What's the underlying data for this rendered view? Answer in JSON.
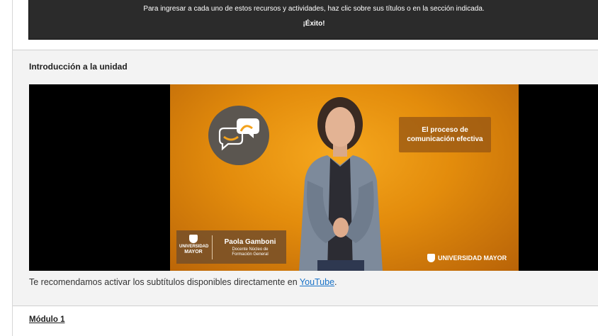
{
  "banner": {
    "instructions": "Para ingresar a cada uno de estos recursos y actividades, haz clic sobre sus títulos o en la sección indicada.",
    "success": "¡Éxito!"
  },
  "intro_section": {
    "title": "Introducción a la unidad",
    "video": {
      "card_title_line1": "El proceso de",
      "card_title_line2": "comunicación efectiva",
      "presenter_name": "Paola Gamboni",
      "presenter_role_line1": "Docente Núcleo de",
      "presenter_role_line2": "Formación General",
      "logo_small_line1": "UNIVERSIDAD",
      "logo_small_line2": "MAYOR",
      "brand": "UNIVERSIDAD MAYOR",
      "icon": "chat-bubbles-icon"
    },
    "recommend_text": "Te recomendamos activar los subtítulos disponibles directamente en ",
    "youtube_link": "YouTube",
    "recommend_end": "."
  },
  "module": {
    "title": "Módulo 1"
  },
  "colors": {
    "banner_bg": "#2b2b2b",
    "video_orange": "#f6a81e",
    "link": "#1a73c8",
    "section_bg": "#f3f3f3"
  }
}
